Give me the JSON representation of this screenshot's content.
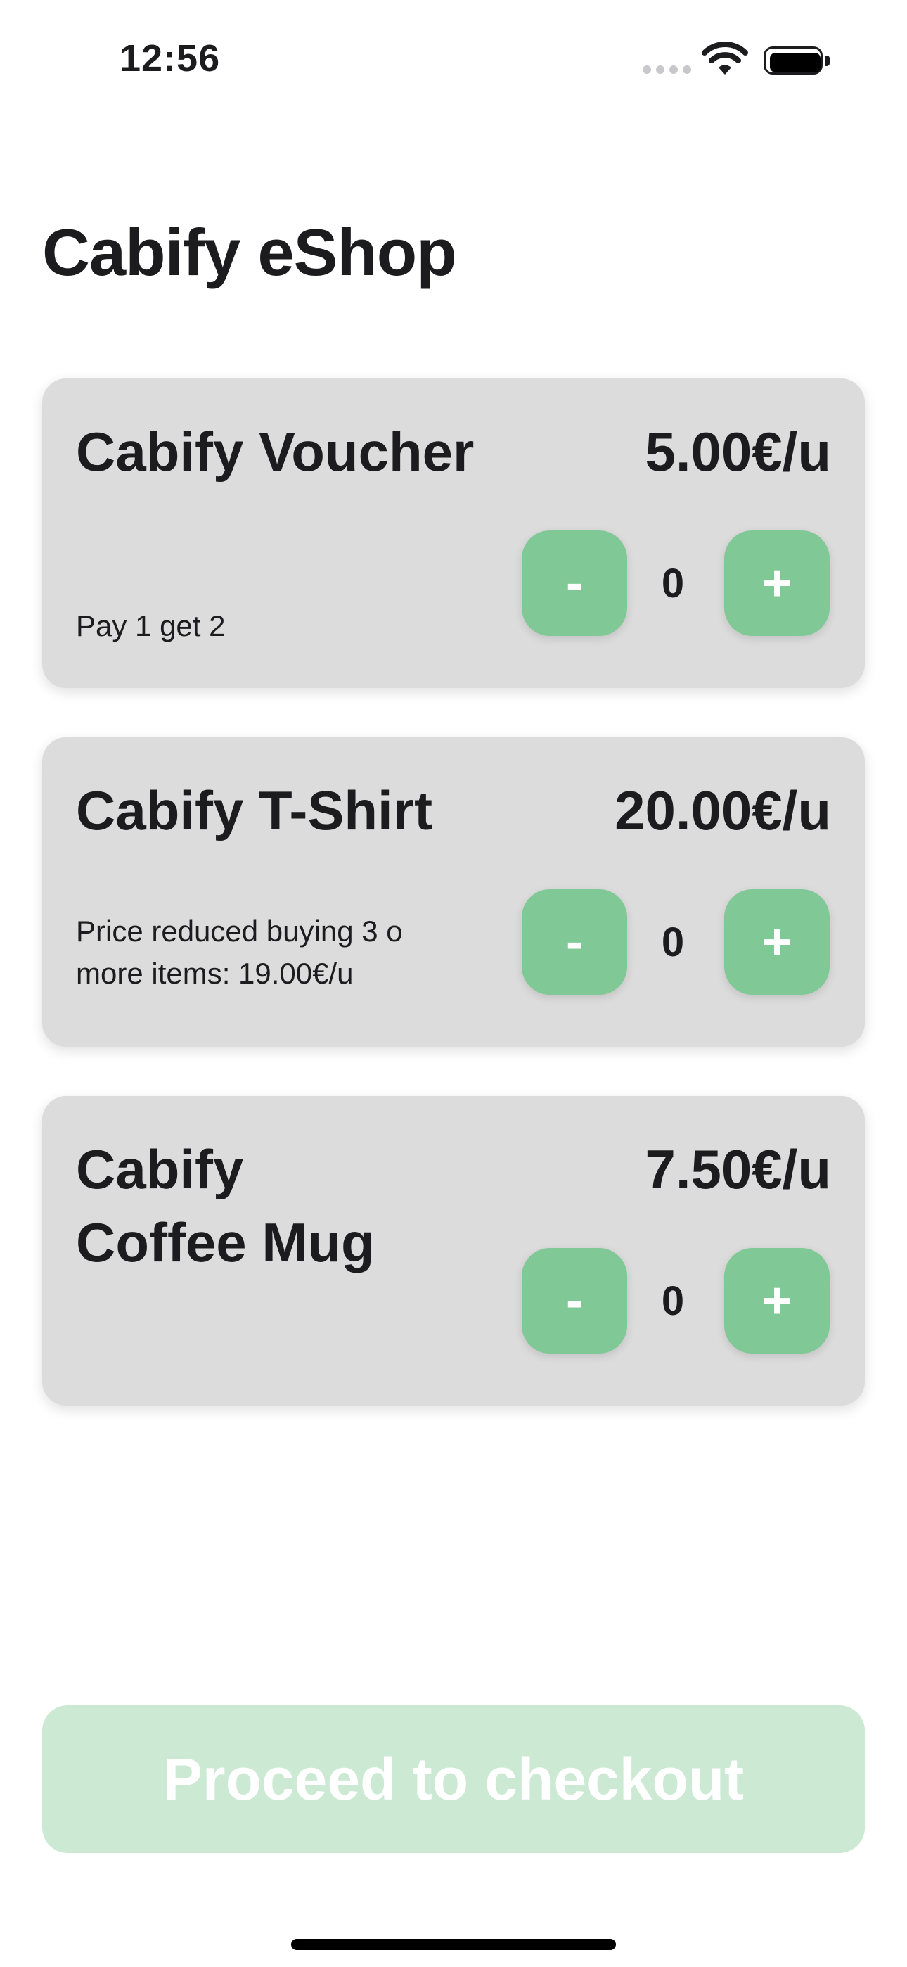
{
  "status_bar": {
    "time": "12:56"
  },
  "title": "Cabify eShop",
  "products": [
    {
      "name": "Cabify Voucher",
      "price": "5.00€/u",
      "description": "Pay 1 get 2",
      "quantity": "0",
      "minus_label": "-",
      "plus_label": "+"
    },
    {
      "name": "Cabify T-Shirt",
      "price": "20.00€/u",
      "description": "Price reduced buying 3 o more items: 19.00€/u",
      "quantity": "0",
      "minus_label": "-",
      "plus_label": "+"
    },
    {
      "name": "Cabify Coffee Mug",
      "price": "7.50€/u",
      "description": "",
      "quantity": "0",
      "minus_label": "-",
      "plus_label": "+"
    }
  ],
  "checkout_label": "Proceed to checkout",
  "colors": {
    "accent": "#80c996",
    "checkout_disabled": "#cce9d4",
    "card_background": "#dcdcdc"
  },
  "icons": [
    "cellular-signal-icon",
    "wifi-icon",
    "battery-icon"
  ]
}
